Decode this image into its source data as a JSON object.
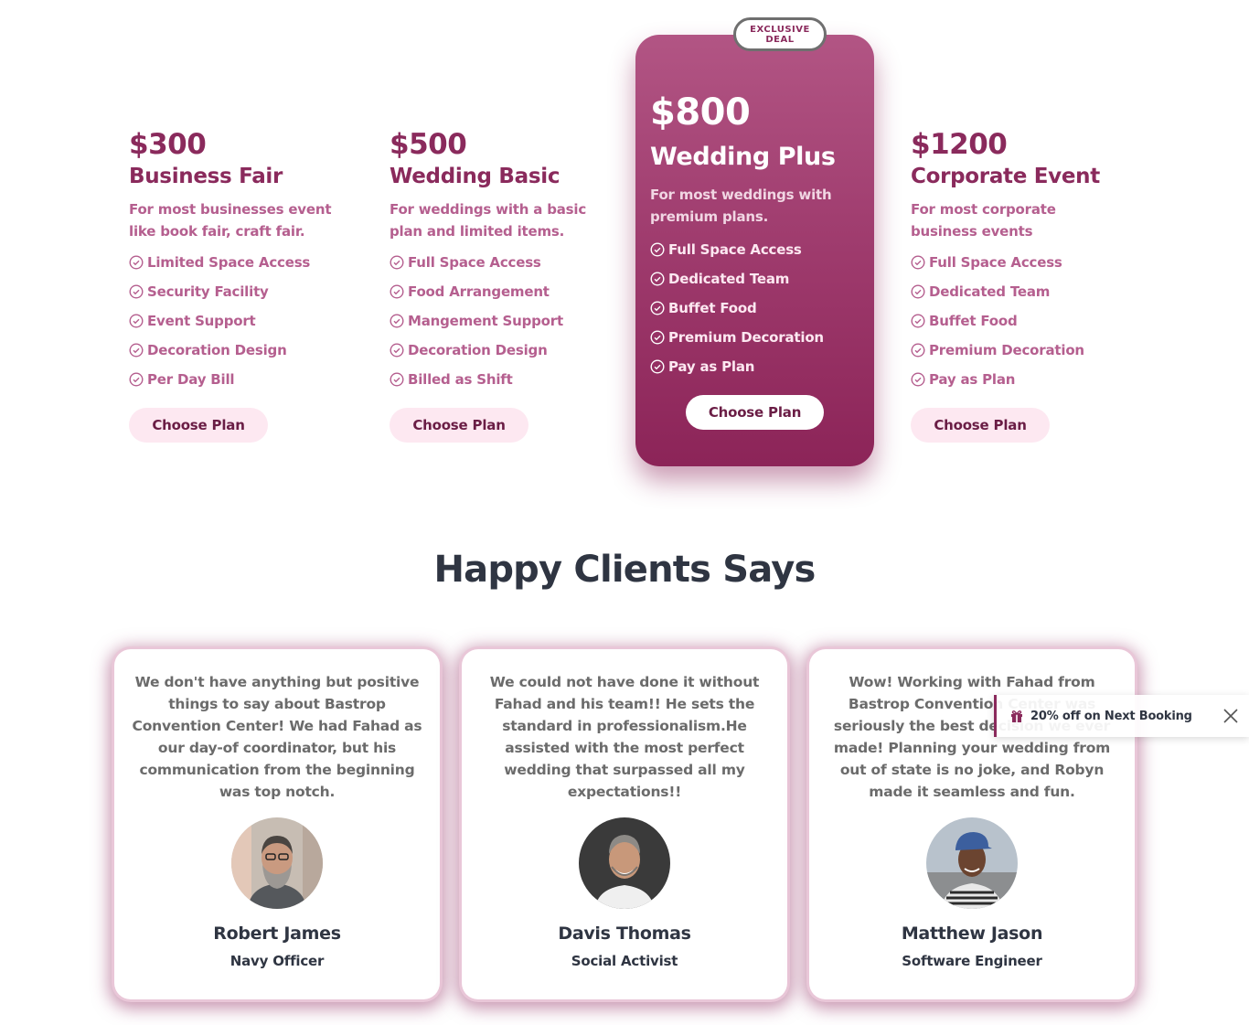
{
  "pricing": {
    "plans": [
      {
        "price": "$300",
        "name": "Business Fair",
        "desc_line1": "For most businesses event",
        "desc_line2": "like book fair, craft fair.",
        "features": [
          "Limited Space Access",
          "Security Facility",
          "Event Support",
          "Decoration Design",
          "Per Day Bill"
        ],
        "button": "Choose Plan"
      },
      {
        "price": "$500",
        "name": "Wedding Basic",
        "desc_line1": "For weddings with a basic",
        "desc_line2": "plan and limited items.",
        "features": [
          "Full Space Access",
          "Food Arrangement",
          "Mangement Support",
          "Decoration Design",
          "Billed as Shift"
        ],
        "button": "Choose Plan"
      },
      {
        "price": "$800",
        "name": "Wedding Plus",
        "desc_line1": "For most weddings with",
        "desc_line2": "premium plans.",
        "features": [
          "Full Space Access",
          "Dedicated Team",
          "Buffet Food",
          "Premium Decoration",
          "Pay as Plan"
        ],
        "button": "Choose Plan",
        "badge_line1": "EXCLUSIVE",
        "badge_line2": "DEAL"
      },
      {
        "price": "$1200",
        "name": "Corporate Event",
        "desc_line1": "For most corporate",
        "desc_line2": "business events",
        "features": [
          "Full Space Access",
          "Dedicated Team",
          "Buffet Food",
          "Premium Decoration",
          "Pay as Plan"
        ],
        "button": "Choose Plan"
      }
    ]
  },
  "testimonials": {
    "title": "Happy Clients Says",
    "items": [
      {
        "lines": [
          "We don't have anything but positive",
          "things to say about Bastrop",
          "Convention Center! We had Fahad as",
          "our day-of coordinator, but his",
          "communication from the beginning",
          "was top notch."
        ],
        "name": "Robert James",
        "role": "Navy Officer"
      },
      {
        "lines": [
          "We could not have done it without",
          "Fahad and his team!! He sets the",
          "standard in professionalism.He",
          "assisted with the most perfect",
          "wedding that surpassed all my",
          "expectations!!"
        ],
        "name": "Davis Thomas",
        "role": "Social Activist"
      },
      {
        "lines": [
          "Wow! Working with Fahad from",
          "Bastrop Convention Center was",
          "seriously the best decision we ever",
          "made! Planning your wedding from",
          "out of state is no joke, and Robyn",
          "made it seamless and fun."
        ],
        "name": "Matthew Jason",
        "role": "Software Engineer"
      }
    ]
  },
  "toast": {
    "message": "20% off on Next Booking",
    "icon": "gift-icon",
    "close_icon": "close-icon"
  },
  "colors": {
    "brand": "#8a2a5c",
    "brand_light": "#b55f8f",
    "button_bg": "#fde8f1",
    "heading": "#2f3542"
  }
}
